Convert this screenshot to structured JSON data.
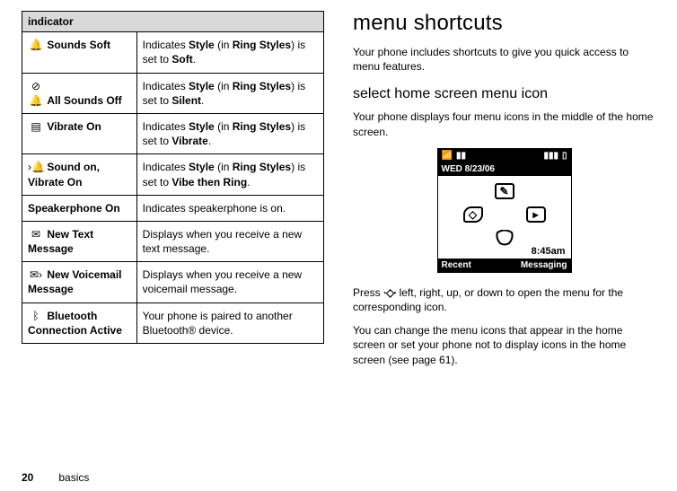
{
  "page_number": "20",
  "footer_label": "basics",
  "left": {
    "header": "indicator",
    "rows": [
      {
        "icon": "🔔",
        "name_plain": "Sounds Soft",
        "desc_parts": [
          "Indicates ",
          {
            "b": true,
            "n": true,
            "t": "Style"
          },
          " (in ",
          {
            "b": true,
            "n": true,
            "t": "Ring Styles"
          },
          ") is set to ",
          {
            "b": true,
            "n": true,
            "t": "Soft"
          },
          "."
        ]
      },
      {
        "icon": "⊘🔔",
        "name_plain": "All Sounds Off",
        "desc_parts": [
          "Indicates ",
          {
            "b": true,
            "n": true,
            "t": "Style"
          },
          " (in ",
          {
            "b": true,
            "n": true,
            "t": "Ring Styles"
          },
          ") is set to ",
          {
            "b": true,
            "n": true,
            "t": "Silent"
          },
          "."
        ]
      },
      {
        "icon": "▤",
        "name_plain": "Vibrate On",
        "desc_parts": [
          "Indicates ",
          {
            "b": true,
            "n": true,
            "t": "Style"
          },
          " (in ",
          {
            "b": true,
            "n": true,
            "t": "Ring Styles"
          },
          ") is set to ",
          {
            "b": true,
            "n": true,
            "t": "Vibrate"
          },
          "."
        ]
      },
      {
        "icon": "›🔔",
        "name_plain": "Sound on, Vibrate On",
        "desc_parts": [
          "Indicates ",
          {
            "b": true,
            "n": true,
            "t": "Style"
          },
          " (in ",
          {
            "b": true,
            "n": true,
            "t": "Ring Styles"
          },
          ") is set to ",
          {
            "b": true,
            "n": true,
            "t": "Vibe then Ring"
          },
          "."
        ]
      },
      {
        "icon": "",
        "name_narrow": "Speakerphone On",
        "desc_parts": [
          "Indicates speakerphone is on."
        ]
      },
      {
        "icon": "✉",
        "name_plain": "New Text Message",
        "desc_parts": [
          "Displays when you receive a new text message."
        ]
      },
      {
        "icon": "✉›",
        "name_plain": "New Voicemail Message",
        "desc_parts": [
          "Displays when you receive a new voicemail message."
        ]
      },
      {
        "icon": "ᛒ",
        "name_plain": "Bluetooth Connection Active",
        "desc_parts": [
          "Your phone is paired to another Bluetooth® device."
        ]
      }
    ]
  },
  "right": {
    "h1": "menu shortcuts",
    "p1": "Your phone includes shortcuts to give you quick access to menu features.",
    "h2": "select home screen menu icon",
    "p2": "Your phone displays four menu icons in the middle of the home screen.",
    "phone": {
      "signal": "▮▮",
      "batt": "▮▮▮",
      "date": "WED 8/23/06",
      "time": "8:45am",
      "left_soft": "Recent",
      "right_soft": "Messaging"
    },
    "p3_pre": "Press ",
    "nav_glyph": "·◇·",
    "p3_post": " left, right, up, or down to open the menu for the corresponding icon.",
    "p4": "You can change the menu icons that appear in the home screen or set your phone not to display icons in the home screen (see page 61)."
  }
}
